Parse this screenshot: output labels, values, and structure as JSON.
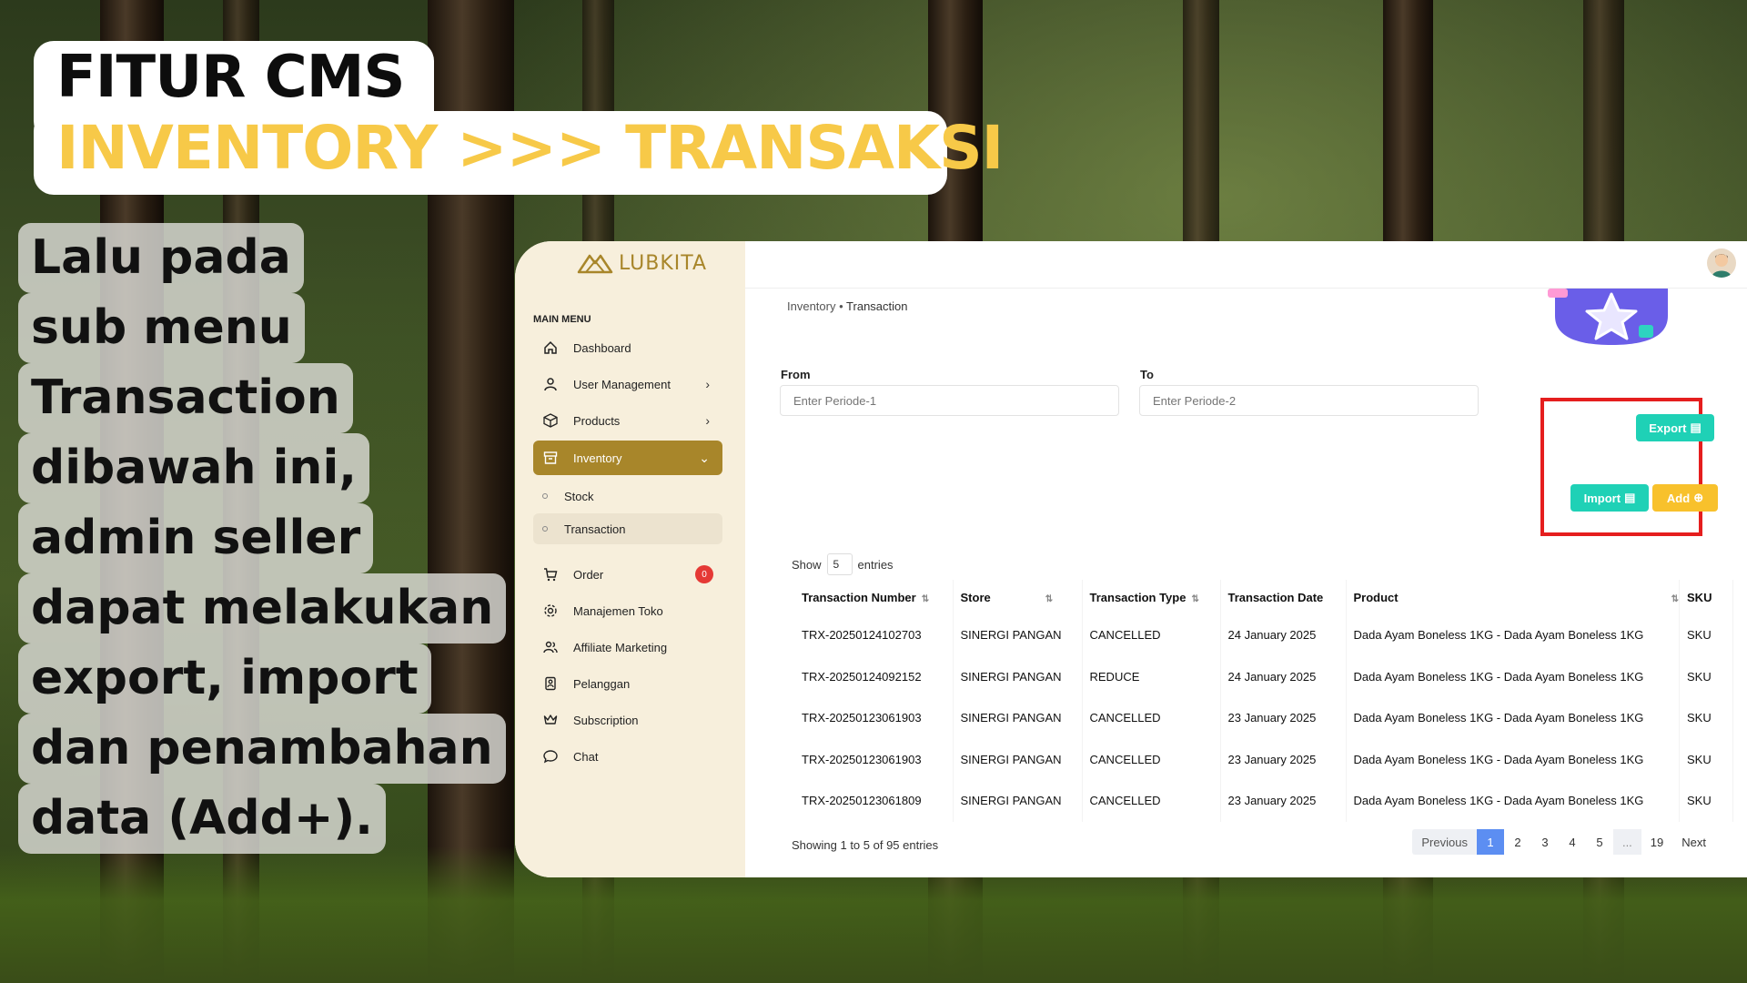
{
  "slide": {
    "title_line1": "FITUR CMS",
    "title_line2": "INVENTORY >>> TRANSAKSI",
    "description_lines": [
      "Lalu pada",
      "sub menu",
      "Transaction",
      "dibawah ini,",
      "admin seller",
      "dapat melakukan",
      "export, import",
      "dan penambahan",
      "data (Add+)."
    ]
  },
  "app": {
    "logo_text": "LUBKITA",
    "sidebar": {
      "heading": "MAIN MENU",
      "items": [
        {
          "label": "Dashboard",
          "icon": "home-icon"
        },
        {
          "label": "User Management",
          "icon": "user-icon",
          "chevron": true
        },
        {
          "label": "Products",
          "icon": "box-icon",
          "chevron": true
        },
        {
          "label": "Inventory",
          "icon": "archive-icon",
          "chevron": true,
          "active": true
        },
        {
          "label": "Order",
          "icon": "cart-icon",
          "badge": "0"
        },
        {
          "label": "Manajemen Toko",
          "icon": "gear-icon"
        },
        {
          "label": "Affiliate Marketing",
          "icon": "users-icon"
        },
        {
          "label": "Pelanggan",
          "icon": "customer-icon"
        },
        {
          "label": "Subscription",
          "icon": "crown-icon"
        },
        {
          "label": "Chat",
          "icon": "chat-icon"
        }
      ],
      "sub_items": [
        {
          "label": "Stock"
        },
        {
          "label": "Transaction",
          "active": true
        }
      ]
    },
    "breadcrumb": {
      "parent": "Inventory",
      "current": "Transaction"
    },
    "filters": {
      "from_label": "From",
      "from_placeholder": "Enter Periode-1",
      "to_label": "To",
      "to_placeholder": "Enter Periode-2"
    },
    "buttons": {
      "export": "Export",
      "import": "Import",
      "add": "Add"
    },
    "table": {
      "show_label": "Show",
      "show_value": "5",
      "entries_label": "entries",
      "columns": [
        "Transaction Number",
        "Store",
        "Transaction Type",
        "Transaction Date",
        "Product",
        "SKU"
      ],
      "rows": [
        [
          "TRX-20250124102703",
          "SINERGI PANGAN",
          "CANCELLED",
          "24 January 2025",
          "Dada Ayam Boneless 1KG - Dada Ayam Boneless 1KG",
          "SKU"
        ],
        [
          "TRX-20250124092152",
          "SINERGI PANGAN",
          "REDUCE",
          "24 January 2025",
          "Dada Ayam Boneless 1KG - Dada Ayam Boneless 1KG",
          "SKU"
        ],
        [
          "TRX-20250123061903",
          "SINERGI PANGAN",
          "CANCELLED",
          "23 January 2025",
          "Dada Ayam Boneless 1KG - Dada Ayam Boneless 1KG",
          "SKU"
        ],
        [
          "TRX-20250123061903",
          "SINERGI PANGAN",
          "CANCELLED",
          "23 January 2025",
          "Dada Ayam Boneless 1KG - Dada Ayam Boneless 1KG",
          "SKU"
        ],
        [
          "TRX-20250123061809",
          "SINERGI PANGAN",
          "CANCELLED",
          "23 January 2025",
          "Dada Ayam Boneless 1KG - Dada Ayam Boneless 1KG",
          "SKU"
        ]
      ],
      "info": "Showing 1 to 5 of 95 entries"
    },
    "pagination": {
      "previous": "Previous",
      "pages": [
        "1",
        "2",
        "3",
        "4",
        "5",
        "...",
        "19"
      ],
      "current": "1",
      "next": "Next"
    },
    "colors": {
      "brand": "#a8862a",
      "sidebar_bg": "#f7efdc",
      "teal": "#1fd1b6",
      "yellow": "#f8c12c",
      "highlight": "#e51e1e",
      "title_yellow": "#f7c948",
      "pager_active": "#5c8ef2"
    }
  }
}
